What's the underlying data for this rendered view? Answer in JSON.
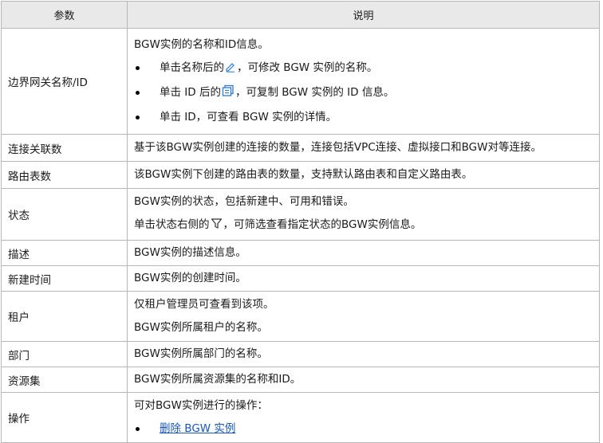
{
  "header": {
    "param": "参数",
    "desc": "说明"
  },
  "rows": [
    {
      "name": "边界网关名称/ID",
      "line0": "BGW实例的名称和ID信息。",
      "b1a": "单击名称后的",
      "b1b": "，可修改 BGW 实例的名称。",
      "b2a": "单击 ID 后的",
      "b2b": "，可复制 BGW 实例的 ID 信息。",
      "b3": "单击 ID，可查看 BGW 实例的详情。"
    },
    {
      "name": "连接关联数",
      "line0": "基于该BGW实例创建的连接的数量，连接包括VPC连接、虚拟接口和BGW对等连接。"
    },
    {
      "name": "路由表数",
      "line0": "该BGW实例下创建的路由表的数量，支持默认路由表和自定义路由表。"
    },
    {
      "name": "状态",
      "line0": "BGW实例的状态，包括新建中、可用和错误。",
      "line1a": "单击状态右侧的",
      "line1b": "，可筛选查看指定状态的BGW实例信息。"
    },
    {
      "name": "描述",
      "line0": "BGW实例的描述信息。"
    },
    {
      "name": "新建时间",
      "line0": "BGW实例的创建时间。"
    },
    {
      "name": "租户",
      "line0": "仅租户管理员可查看到该项。",
      "line1": "BGW实例所属租户的名称。"
    },
    {
      "name": "部门",
      "line0": "BGW实例所属部门的名称。"
    },
    {
      "name": "资源集",
      "line0": "BGW实例所属资源集的名称和ID。"
    },
    {
      "name": "操作",
      "line0": "可对BGW实例进行的操作：",
      "link": "删除 BGW 实例"
    }
  ],
  "icons": [
    "edit-icon",
    "copy-icon",
    "filter-icon"
  ],
  "colors": {
    "header_bg": "#e9e9e9",
    "border": "#b7b7b7",
    "link": "#1a56b5",
    "icon": "#2b7bd6"
  }
}
